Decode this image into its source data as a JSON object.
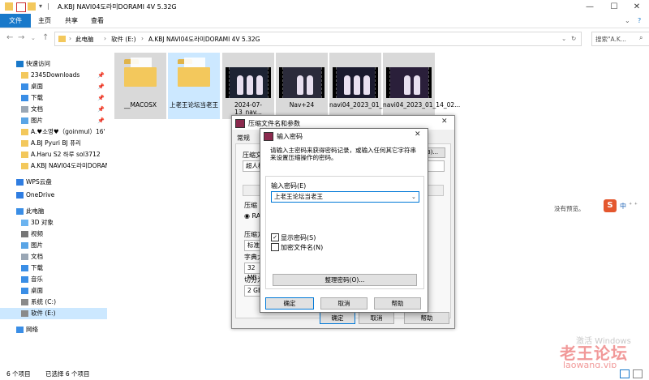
{
  "window": {
    "title": "A.KBJ NAVI04도라미DORAMI 4V 5.32G"
  },
  "ribbon": {
    "tabs": [
      "文件",
      "主页",
      "共享",
      "查看"
    ]
  },
  "address": {
    "path": [
      "此电脑",
      "软件 (E:)",
      "A.KBJ NAVI04도라미DORAMI 4V 5.32G"
    ],
    "search_placeholder": "搜索\"A.K..."
  },
  "sidebar": {
    "items": [
      {
        "label": "快速访问",
        "icon": "star-icon",
        "pinned": false,
        "selected": false,
        "indent": 1
      },
      {
        "label": "2345Downloads",
        "icon": "folder-icon",
        "pinned": true,
        "selected": false,
        "indent": 2
      },
      {
        "label": "桌面",
        "icon": "desktop-icon",
        "pinned": true,
        "selected": false,
        "indent": 2
      },
      {
        "label": "下载",
        "icon": "download-icon",
        "pinned": true,
        "selected": false,
        "indent": 2
      },
      {
        "label": "文档",
        "icon": "document-icon",
        "pinned": true,
        "selected": false,
        "indent": 2
      },
      {
        "label": "图片",
        "icon": "picture-icon",
        "pinned": true,
        "selected": false,
        "indent": 2
      },
      {
        "label": "A.♥소영♥（goinmul）16'",
        "icon": "folder-icon",
        "pinned": false,
        "selected": false,
        "indent": 2
      },
      {
        "label": "A.BJ Pyuri  BJ 퓨리",
        "icon": "folder-icon",
        "pinned": false,
        "selected": false,
        "indent": 2
      },
      {
        "label": "A.Haru S2 하루  sol3712",
        "icon": "folder-icon",
        "pinned": false,
        "selected": false,
        "indent": 2
      },
      {
        "label": "A.KBJ NAVI04도라미DORAMI",
        "icon": "folder-icon",
        "pinned": false,
        "selected": false,
        "indent": 2
      },
      {
        "label": "WPS云盘",
        "icon": "cloud-icon",
        "pinned": false,
        "selected": false,
        "indent": 1
      },
      {
        "label": "OneDrive",
        "icon": "onedrive-icon",
        "pinned": false,
        "selected": false,
        "indent": 1
      },
      {
        "label": "此电脑",
        "icon": "computer-icon",
        "pinned": false,
        "selected": false,
        "indent": 1
      },
      {
        "label": "3D 对象",
        "icon": "cube-icon",
        "pinned": false,
        "selected": false,
        "indent": 2
      },
      {
        "label": "视频",
        "icon": "video-icon",
        "pinned": false,
        "selected": false,
        "indent": 2
      },
      {
        "label": "图片",
        "icon": "picture-icon",
        "pinned": false,
        "selected": false,
        "indent": 2
      },
      {
        "label": "文档",
        "icon": "document-icon",
        "pinned": false,
        "selected": false,
        "indent": 2
      },
      {
        "label": "下载",
        "icon": "download-icon",
        "pinned": false,
        "selected": false,
        "indent": 2
      },
      {
        "label": "音乐",
        "icon": "music-icon",
        "pinned": false,
        "selected": false,
        "indent": 2
      },
      {
        "label": "桌面",
        "icon": "desktop-icon",
        "pinned": false,
        "selected": false,
        "indent": 2
      },
      {
        "label": "系统 (C:)",
        "icon": "drive-icon",
        "pinned": false,
        "selected": false,
        "indent": 2
      },
      {
        "label": "软件 (E:)",
        "icon": "drive-icon",
        "pinned": false,
        "selected": true,
        "indent": 2
      },
      {
        "label": "网络",
        "icon": "network-icon",
        "pinned": false,
        "selected": false,
        "indent": 1
      }
    ]
  },
  "files": [
    {
      "name": "__MACOSX",
      "type": "folder",
      "selected": false
    },
    {
      "name": "上老王论坛当老王",
      "type": "folder",
      "selected": true
    },
    {
      "name": "2024-07-13_nav...",
      "type": "video",
      "selected": false
    },
    {
      "name": "Nav+24",
      "type": "video",
      "selected": false
    },
    {
      "name": "navi04_2023_01_13_05...",
      "type": "video",
      "selected": false
    },
    {
      "name": "navi04_2023_01_14_02...",
      "type": "video",
      "selected": false
    }
  ],
  "preview": {
    "no_preview": "没有预览。"
  },
  "outer_dialog": {
    "title": "压缩文件名和参数",
    "tab": "常规",
    "labels": [
      "压缩文",
      "超人核",
      "压缩",
      "RA",
      "压缩方",
      "标准",
      "字典大",
      "32 MB",
      "切分为",
      "2 GB"
    ],
    "ok": "确定",
    "cancel": "取消",
    "help": "帮助"
  },
  "password_dialog": {
    "title": "输入密码",
    "description": "请输入主密码来获得密码记录，或输入任何其它字符串来设置压缩操作的密码。",
    "field_label": "输入密码(E)",
    "password_value": "上老王论坛当老王",
    "show_password": "显示密码(S)",
    "show_password_checked": true,
    "encrypt_names": "加密文件名(N)",
    "encrypt_names_checked": false,
    "organize_button": "整理密码(O)...",
    "ok": "确定",
    "cancel": "取消",
    "help": "帮助"
  },
  "ime": {
    "label": "中",
    "logo": "S"
  },
  "status": {
    "count": "6 个项目",
    "selected": "已选择 6 个项目"
  },
  "watermark": {
    "activation": "激活 Windows",
    "forum": "老王论坛",
    "site": "laowang.vip"
  }
}
